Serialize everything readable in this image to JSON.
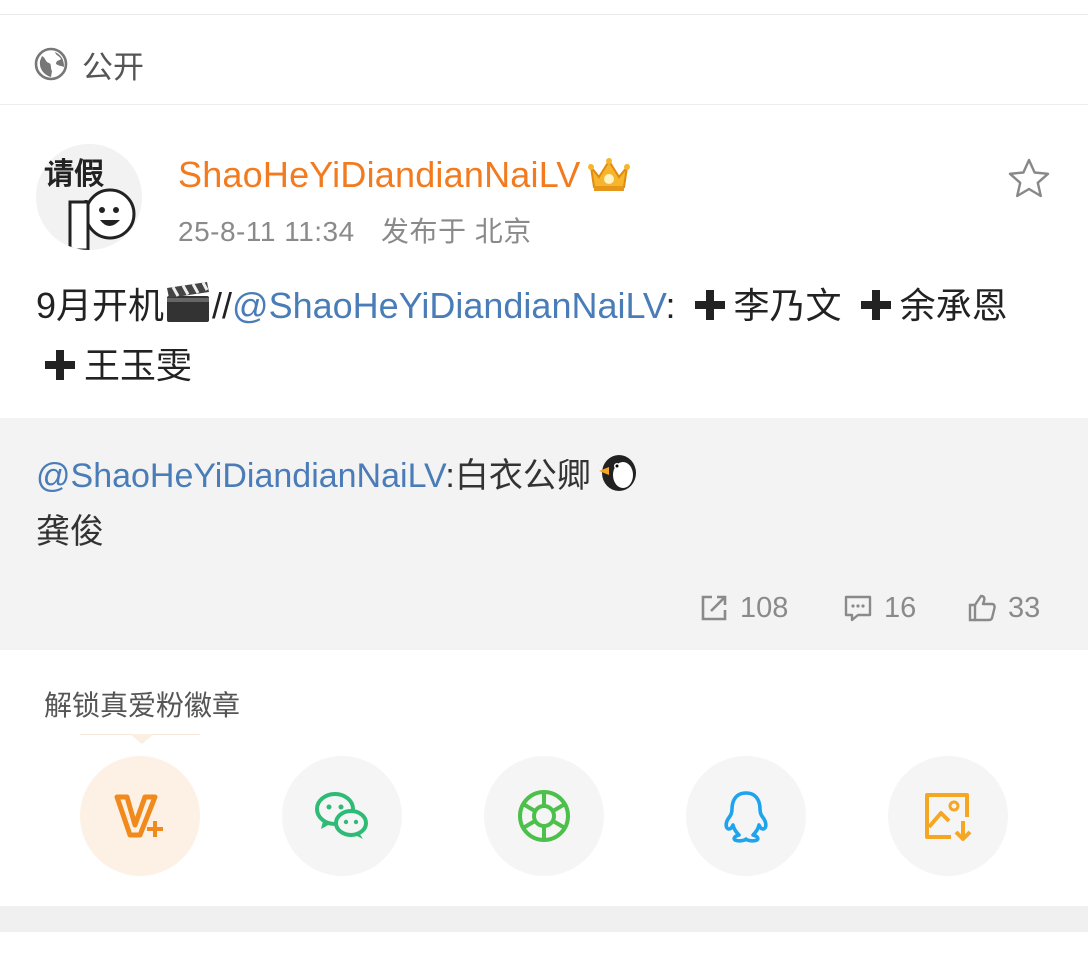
{
  "visibility": {
    "label": "公开",
    "icon": "globe-icon"
  },
  "author": {
    "name": "ShaoHeYiDiandianNaiLV",
    "badge_icon": "crown-icon",
    "avatar_text": "请假",
    "time": "25-8-11 11:34",
    "location": "发布于 北京"
  },
  "post": {
    "text_start": "9月开机",
    "separator": "//",
    "mention": "@ShaoHeYiDiandianNaiLV",
    "colon": ":",
    "name1": "李乃文",
    "name2": "余承恩",
    "name3": "王玉雯"
  },
  "repost": {
    "mention": "@ShaoHeYiDiandianNaiLV",
    "colon_text": ":白衣公卿",
    "second_line": "龚俊"
  },
  "stats": {
    "reposts": "108",
    "comments": "16",
    "likes": "33"
  },
  "share": {
    "unlock_label": "解锁真爱粉徽章",
    "buttons": [
      "v-plus-icon",
      "wechat-icon",
      "moments-icon",
      "qq-icon",
      "save-image-icon"
    ]
  },
  "colors": {
    "username": "#f27b1f",
    "mention": "#4a7db7",
    "meta": "#8a8a8a",
    "repost_bg": "#f3f3f3"
  }
}
